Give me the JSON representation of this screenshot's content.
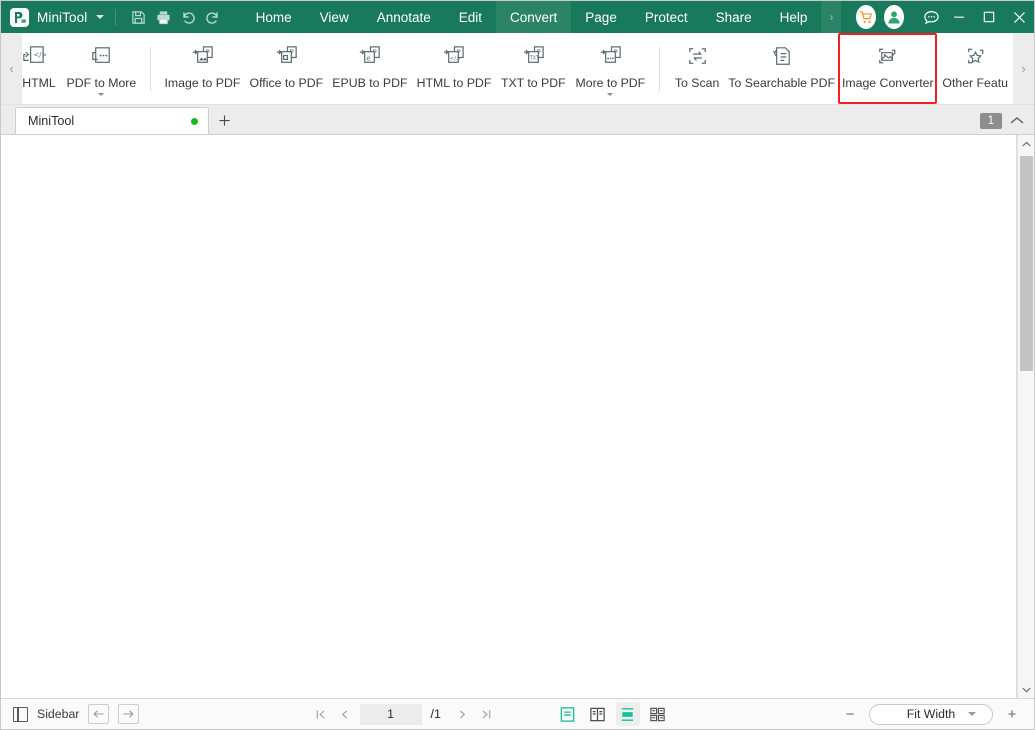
{
  "titlebar": {
    "app_name": "MiniTool",
    "logo_icon": "pdf-logo-icon",
    "dropdown_icon": "chevron-down-icon",
    "quick_actions": [
      {
        "name": "save-button",
        "icon": "save-icon"
      },
      {
        "name": "print-button",
        "icon": "print-icon"
      },
      {
        "name": "undo-button",
        "icon": "undo-icon"
      },
      {
        "name": "redo-button",
        "icon": "redo-icon"
      }
    ],
    "menu": [
      {
        "label": "Home",
        "active": false
      },
      {
        "label": "View",
        "active": false
      },
      {
        "label": "Annotate",
        "active": false
      },
      {
        "label": "Edit",
        "active": false
      },
      {
        "label": "Convert",
        "active": true
      },
      {
        "label": "Page",
        "active": false
      },
      {
        "label": "Protect",
        "active": false
      },
      {
        "label": "Share",
        "active": false
      },
      {
        "label": "Help",
        "active": false
      }
    ],
    "menu_overflow_icon": "chevron-right-icon",
    "cart_icon": "shopping-cart-icon",
    "account_icon": "user-account-icon",
    "chat_icon": "chat-bubble-icon",
    "minimize_icon": "minimize-icon",
    "maximize_icon": "maximize-icon",
    "close_icon": "close-icon",
    "colors": {
      "header_green": "#18795c",
      "active_tab_green": "#2c8467",
      "cart_orange": "#f0932b",
      "account_green": "#2fa46e"
    }
  },
  "ribbon": {
    "scroll_left_icon": "chevron-left-icon",
    "scroll_right_icon": "chevron-right-icon",
    "highlight_color": "#ef2020",
    "items": [
      {
        "label": "o HTML",
        "icon": "pdf-to-html-icon",
        "has_dropdown": false,
        "highlight": false,
        "clipped": true
      },
      {
        "label": "PDF to More",
        "icon": "pdf-to-more-icon",
        "has_dropdown": true,
        "highlight": false
      },
      {
        "separator": true
      },
      {
        "label": "Image to PDF",
        "icon": "image-to-pdf-icon",
        "has_dropdown": false,
        "highlight": false
      },
      {
        "label": "Office to PDF",
        "icon": "office-to-pdf-icon",
        "has_dropdown": false,
        "highlight": false
      },
      {
        "label": "EPUB to PDF",
        "icon": "epub-to-pdf-icon",
        "has_dropdown": false,
        "highlight": false
      },
      {
        "label": "HTML to PDF",
        "icon": "html-to-pdf-icon",
        "has_dropdown": false,
        "highlight": false
      },
      {
        "label": "TXT to PDF",
        "icon": "txt-to-pdf-icon",
        "has_dropdown": false,
        "highlight": false
      },
      {
        "label": "More to PDF",
        "icon": "more-to-pdf-icon",
        "has_dropdown": true,
        "highlight": false
      },
      {
        "separator": true
      },
      {
        "label": "To Scan",
        "icon": "to-scan-icon",
        "has_dropdown": false,
        "highlight": false
      },
      {
        "label": "To Searchable PDF",
        "icon": "to-searchable-pdf-icon",
        "has_dropdown": false,
        "highlight": false
      },
      {
        "label": "Image Converter",
        "icon": "image-converter-icon",
        "has_dropdown": false,
        "highlight": true
      },
      {
        "label": "Other Featu",
        "icon": "other-features-icon",
        "has_dropdown": false,
        "highlight": false
      }
    ]
  },
  "tabstrip": {
    "doc_tab_label": "MiniTool",
    "doc_tab_status_color": "#22b520",
    "new_tab_icon": "plus-icon",
    "page_badge": "1",
    "collapse_icon": "chevron-up-icon"
  },
  "statusbar": {
    "sidebar_label": "Sidebar",
    "sidebar_icon": "sidebar-panel-icon",
    "back_icon": "arrow-left-icon",
    "forward_icon": "arrow-right-icon",
    "first_page_icon": "first-page-icon",
    "prev_page_icon": "prev-page-icon",
    "page_value": "1",
    "page_total": "/1",
    "next_page_icon": "next-page-icon",
    "last_page_icon": "last-page-icon",
    "view_modes": [
      {
        "name": "single-page-view",
        "icon": "single-page-icon",
        "state": "active"
      },
      {
        "name": "two-page-view",
        "icon": "two-page-icon",
        "state": "normal"
      },
      {
        "name": "continuous-scroll-view",
        "icon": "continuous-scroll-icon",
        "state": "active-bg"
      },
      {
        "name": "grid-thumbnail-view",
        "icon": "grid-thumbnail-icon",
        "state": "normal"
      }
    ],
    "zoom_out_label": "−",
    "zoom_level": "Fit Width",
    "zoom_dropdown_icon": "chevron-down-icon",
    "zoom_in_label": "+",
    "accent_teal": "#18bf9a"
  },
  "scrollbar": {
    "up_icon": "chevron-up-icon",
    "down_icon": "chevron-down-icon"
  }
}
